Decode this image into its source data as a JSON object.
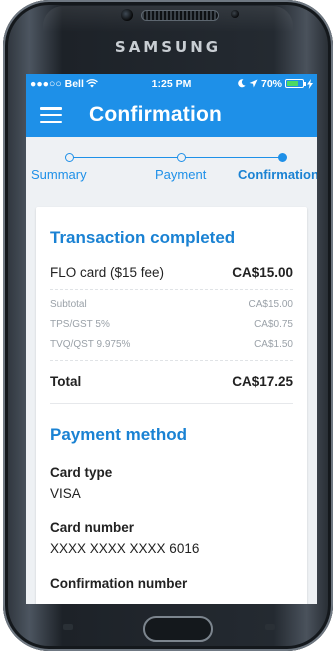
{
  "device": {
    "brand": "SAMSUNG"
  },
  "status_bar": {
    "carrier": "●●●○○ Bell",
    "time": "1:25 PM",
    "battery_text": "70%",
    "battery_level": 0.7
  },
  "app_bar": {
    "title": "Confirmation"
  },
  "stepper": {
    "steps": [
      {
        "label": "Summary"
      },
      {
        "label": "Payment"
      },
      {
        "label": "Confirmation"
      }
    ],
    "active_index": 2
  },
  "transaction": {
    "title": "Transaction completed",
    "item": {
      "label": "FLO card ($15 fee)",
      "amount": "CA$15.00"
    },
    "subtotal": {
      "label": "Subtotal",
      "amount": "CA$15.00"
    },
    "tax1": {
      "label": "TPS/GST 5%",
      "amount": "CA$0.75"
    },
    "tax2": {
      "label": "TVQ/QST 9.975%",
      "amount": "CA$1.50"
    },
    "total": {
      "label": "Total",
      "amount": "CA$17.25"
    }
  },
  "payment_method": {
    "title": "Payment method",
    "card_type_label": "Card type",
    "card_type_value": "VISA",
    "card_number_label": "Card number",
    "card_number_value": "XXXX XXXX XXXX 6016",
    "partial_label": "Confirmation number"
  },
  "colors": {
    "accent": "#1e90e8",
    "battery": "#4cd964"
  }
}
